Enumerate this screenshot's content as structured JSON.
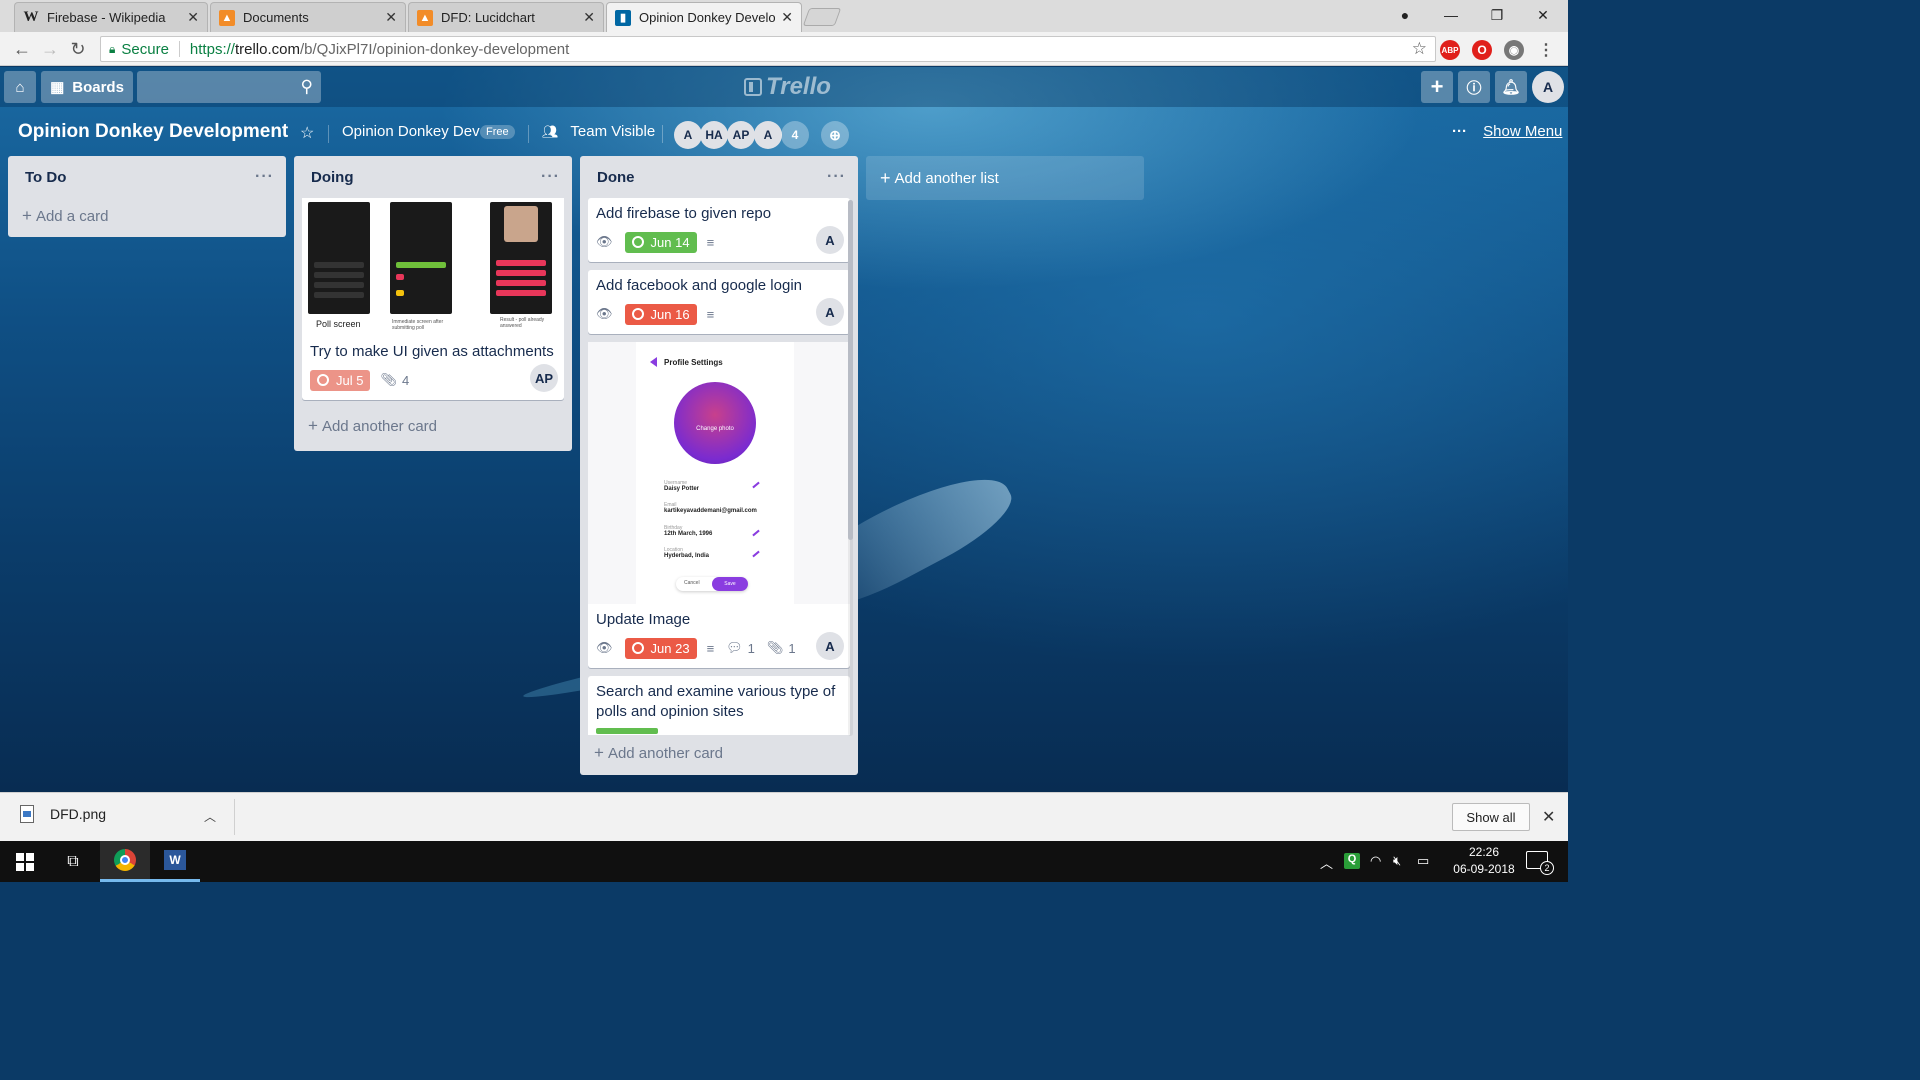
{
  "browser": {
    "tabs": [
      {
        "favicon": "W",
        "title": "Firebase - Wikipedia",
        "close": "✕"
      },
      {
        "favicon": "",
        "title": "Documents",
        "close": "✕"
      },
      {
        "favicon": "",
        "title": "DFD: Lucidchart",
        "close": "✕"
      },
      {
        "favicon": "",
        "title": "Opinion Donkey Develop",
        "close": "✕"
      }
    ],
    "address": {
      "secure_label": "Secure",
      "scheme": "https://",
      "host": "trello.com",
      "path": "/b/QJixPl7I/opinion-donkey-development"
    },
    "extensions": [
      "ABP",
      "opera-icon",
      "globe-icon",
      "menu-icon"
    ]
  },
  "trello": {
    "header": {
      "boards_label": "Boards",
      "logo_text": "Trello",
      "user_initial": "A"
    },
    "board": {
      "title": "Opinion Donkey Development",
      "team": "Opinion Donkey Dev",
      "plan_badge": "Free",
      "visibility": "Team Visible",
      "members": [
        "A",
        "HA",
        "AP",
        "A"
      ],
      "member_overflow": "4",
      "show_menu": "Show Menu"
    },
    "lists": [
      {
        "name": "To Do",
        "add_card": "Add a card"
      },
      {
        "name": "Doing",
        "cards": [
          {
            "cover_captions": [
              "Poll screen",
              "Immediate screen after submitting poll",
              "Result - poll already answered"
            ],
            "title": "Try to make UI given as attachments",
            "due": "Jul 5",
            "attachments": "4",
            "member": "AP"
          }
        ],
        "add_card": "Add another card"
      },
      {
        "name": "Done",
        "cards": [
          {
            "title": "Add firebase to given repo",
            "due": "Jun 14",
            "due_status": "complete",
            "member": "A"
          },
          {
            "title": "Add facebook and google login",
            "due": "Jun 16",
            "due_status": "overdue",
            "member": "A"
          },
          {
            "cover": {
              "heading": "Profile Settings",
              "change_photo": "Change photo",
              "fields": [
                {
                  "label": "Username",
                  "value": "Daisy Potter"
                },
                {
                  "label": "Email",
                  "value": "kartikeyavaddemani@gmail.com"
                },
                {
                  "label": "Birthday",
                  "value": "12th March, 1996"
                },
                {
                  "label": "Location",
                  "value": "Hyderbad, India"
                }
              ],
              "cancel": "Cancel",
              "save": "Save"
            },
            "title": "Update Image",
            "due": "Jun 23",
            "due_status": "overdue",
            "comments": "1",
            "attachments": "1",
            "member": "A"
          },
          {
            "title": "Search and examine various type of polls and opinion sites"
          }
        ],
        "add_card": "Add another card"
      }
    ],
    "add_list": "Add another list"
  },
  "downloads": {
    "file": "DFD.png",
    "show_all": "Show all"
  },
  "taskbar": {
    "time": "22:26",
    "date": "06-09-2018",
    "notifications": "2"
  },
  "colors": {
    "due_complete": "#61bd4f",
    "due_overdue": "#eb5a46",
    "list_bg": "#dfe1e6"
  }
}
